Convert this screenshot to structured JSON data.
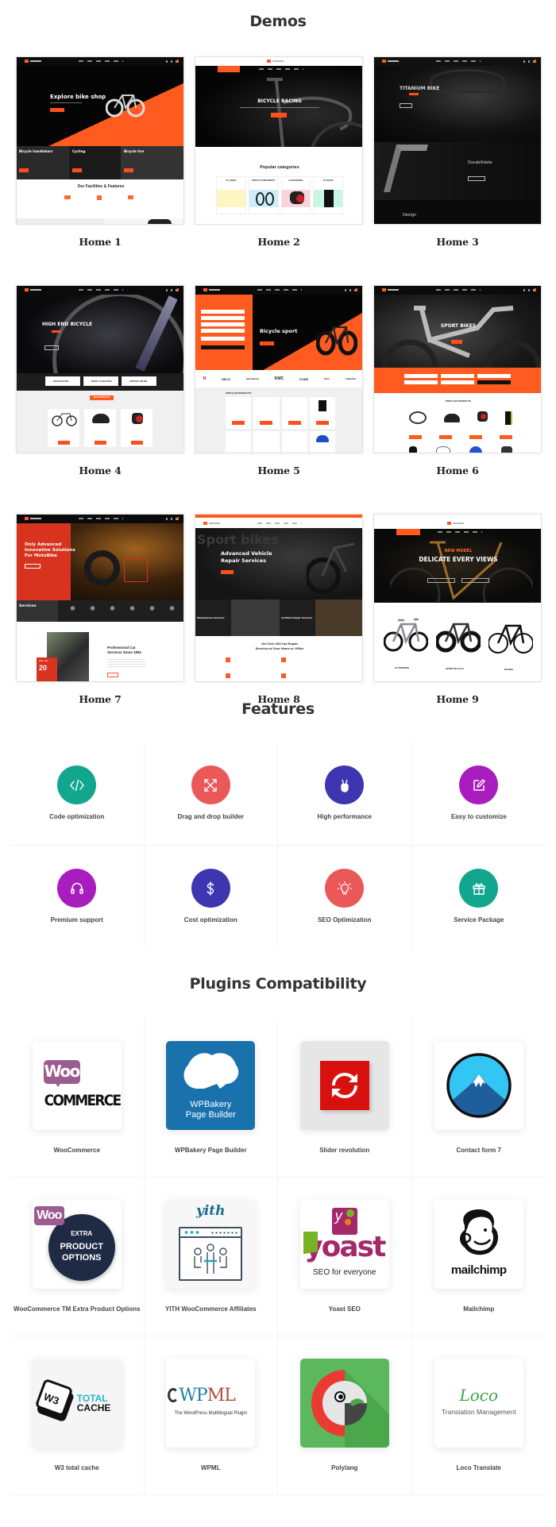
{
  "demos": {
    "title": "Demos",
    "items": [
      {
        "label": "Home 1",
        "hero_text": "Explore bike shop",
        "sub_cards": [
          "Bicycle handlebars",
          "Cycling",
          "Bicycle tire"
        ],
        "section_title": "Our Facilities & Features"
      },
      {
        "label": "Home 2",
        "hero_text": "BICYCLE RACING",
        "section_title": "Popular categories",
        "categories": [
          "ALL BIKES",
          "PARTS & COMPONENTS",
          "ACCESSORIES",
          "CLOTHING"
        ]
      },
      {
        "label": "Home 3",
        "hero_text": "TITANIUM BIKE",
        "section_1": "Durabilidate",
        "section_2": "Design"
      },
      {
        "label": "Home 4",
        "hero_text": "HIGH END BICYCLE",
        "badges": [
          "FREE DELIVERY",
          "MONEY GUARANTEE",
          "SUPPORT ONLINE"
        ],
        "section_title": "NEW PRODUCTS"
      },
      {
        "label": "Home 5",
        "hero_text": "Bicycle sport",
        "brands": [
          "H",
          "HELO",
          "Specialized",
          "KMC",
          "CODE",
          "Race",
          "Chainline"
        ],
        "section_title": "POPULAR PRODUCTS"
      },
      {
        "label": "Home 6",
        "hero_text": "SPORT BIKES",
        "section_title": "POPULAR PRODUCTS"
      },
      {
        "label": "Home 7",
        "hero_text_1": "Only Advanced",
        "hero_text_2": "Innovative Solutions",
        "hero_text_3": "For MotoBike",
        "services_label": "Services",
        "about_1": "Professional Car",
        "about_2": "Services Since 1991",
        "counter_prefix": "More Than",
        "counter": "20"
      },
      {
        "label": "Home 8",
        "watermark": "Sport bikes",
        "hero_text_1": "Advanced Vehicle",
        "hero_text_2": "Repair Services",
        "service_1": "Maintenance Services",
        "service_2": "Certified Repair Services",
        "section_title_1": "Get Over 200 Car Repair",
        "section_title_2": "Services at Your Home or Office"
      },
      {
        "label": "Home 9",
        "kicker": "NEW MODEL",
        "hero_text": "DELICATE EVERY VIEWS",
        "products": [
          "GT PREMIUM",
          "SPORT BICYCLE",
          "RACING"
        ]
      }
    ]
  },
  "features": {
    "title": "Features",
    "items": [
      {
        "label": "Code optimization",
        "icon": "code-icon",
        "color": "#13a68f"
      },
      {
        "label": "Drag and drop builder",
        "icon": "arrows-expand-icon",
        "color": "#ea5858"
      },
      {
        "label": "High performance",
        "icon": "victory-hand-icon",
        "color": "#3d36b0"
      },
      {
        "label": "Easy to customize",
        "icon": "edit-icon",
        "color": "#a71dbd"
      },
      {
        "label": "Premium support",
        "icon": "headphones-icon",
        "color": "#a71dbd"
      },
      {
        "label": "Cost optimization",
        "icon": "dollar-icon",
        "color": "#3d36b0"
      },
      {
        "label": "SEO Optimization",
        "icon": "lightbulb-icon",
        "color": "#ea5858"
      },
      {
        "label": "Service Package",
        "icon": "gift-icon",
        "color": "#13a68f"
      }
    ]
  },
  "plugins": {
    "title": "Plugins Compatibility",
    "items": [
      {
        "label": "WooCommerce",
        "logo_text_1": "Woo",
        "logo_text_2": "COMMERCE"
      },
      {
        "label": "WPBakery Page Builder",
        "logo_text_1": "WPBakery",
        "logo_text_2": "Page Builder"
      },
      {
        "label": "Slider revolution"
      },
      {
        "label": "Contact form 7"
      },
      {
        "label": "WooCommerce TM Extra Product Options",
        "logo_text_1": "Woo",
        "logo_text_2": "EXTRA",
        "logo_text_3": "PRODUCT",
        "logo_text_4": "OPTIONS"
      },
      {
        "label": "YITH WooCommerce Affiliates",
        "logo_text_1": "yith"
      },
      {
        "label": "Yoast SEO",
        "logo_text_1": "yoast",
        "logo_text_2": "SEO for everyone"
      },
      {
        "label": "Mailchimp",
        "logo_text_1": "mailchimp"
      },
      {
        "label": "W3 total cache",
        "logo_text_1": "W3",
        "logo_text_2": "TOTAL",
        "logo_text_3": "CACHE"
      },
      {
        "label": "WPML",
        "logo_text_1": "WPML",
        "logo_text_2": "The WordPress Multilingual Plugin"
      },
      {
        "label": "Polylang"
      },
      {
        "label": "Loco Translate",
        "logo_text_1": "Loco",
        "logo_text_2": "Translation Management"
      }
    ]
  }
}
